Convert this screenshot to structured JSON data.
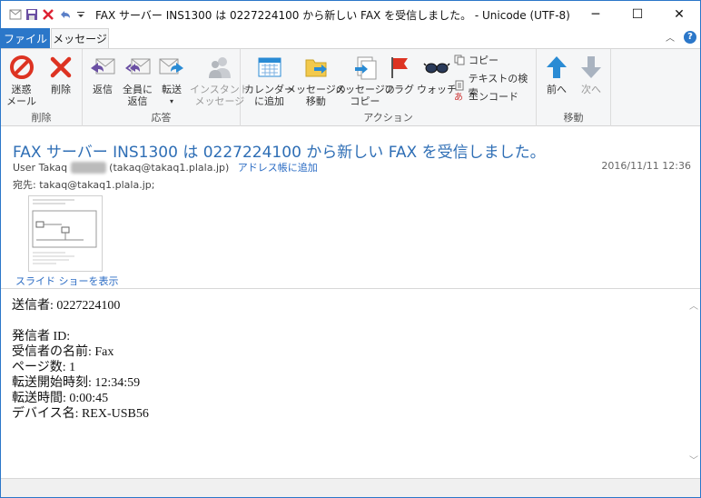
{
  "window": {
    "title": "FAX サーバー INS1300 は 0227224100 から新しい FAX を受信しました。 - Unicode (UTF-8)",
    "qat": [
      "save-icon",
      "delete-icon",
      "undo-icon",
      "customize-icon"
    ]
  },
  "tabs": {
    "file": "ファイル",
    "message": "メッセージ"
  },
  "ribbon": {
    "groups": {
      "delete": "削除",
      "respond": "応答",
      "actions": "アクション",
      "move": "移動"
    },
    "buttons": {
      "junk": "迷惑\nメール",
      "delete": "削除",
      "reply": "返信",
      "reply_all": "全員に\n返信",
      "forward": "転送",
      "instant_message": "インスタント\nメッセージ",
      "add_calendar": "カレンダー\nに追加",
      "move_message": "メッセージの\n移動",
      "copy_message": "メッセージの\nコピー",
      "flag": "フラグ",
      "watch": "ウォッチ",
      "copy": "コピー",
      "find_text": "テキストの検索",
      "encode": "エンコード",
      "previous": "前へ",
      "next": "次へ"
    }
  },
  "message": {
    "subject": "FAX サーバー INS1300 は 0227224100 から新しい FAX を受信しました。",
    "sender_name": "User Takaq",
    "sender_name_blurred": "xxxxxx",
    "sender_email": "(takaq@takaq1.plala.jp)",
    "add_to_address_book": "アドレス帳に追加",
    "date": "2016/11/11 12:36",
    "to_label": "宛先:",
    "to_value": "takaq@takaq1.plala.jp;",
    "slideshow": "スライド ショーを表示"
  },
  "body": {
    "lines": [
      "送信者: 0227224100",
      "",
      "発信者 ID:",
      "受信者の名前: Fax",
      "ページ数: 1",
      "転送開始時刻: 12:34:59",
      "転送時間: 0:00:45",
      "デバイス名: REX-USB56"
    ]
  }
}
